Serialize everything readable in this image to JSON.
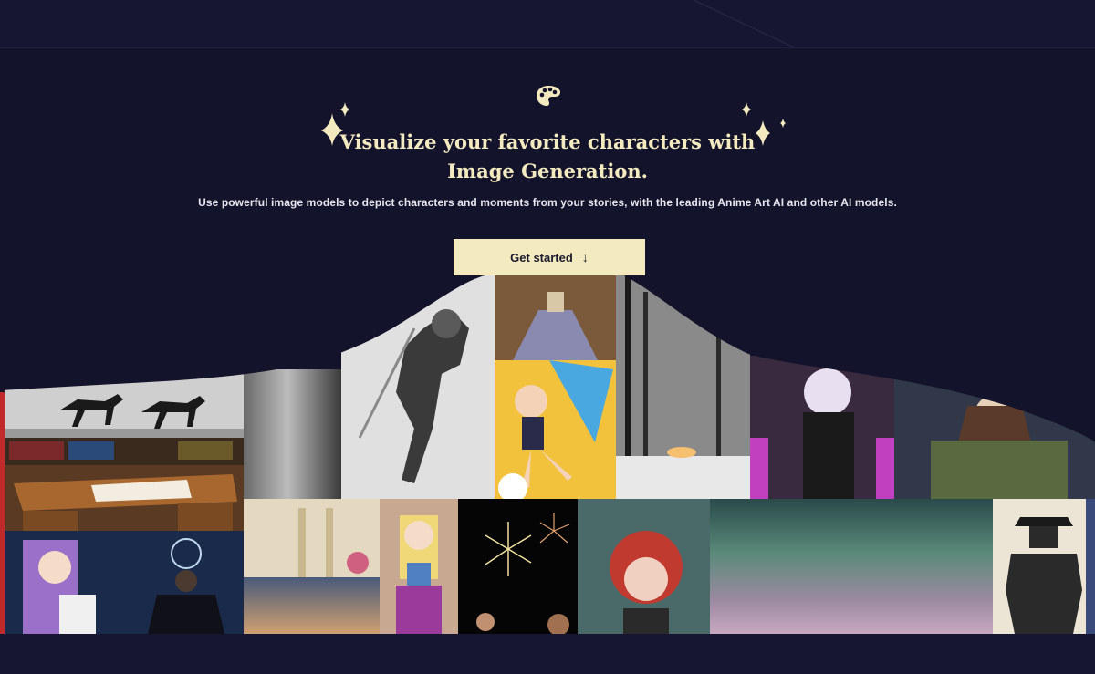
{
  "hero": {
    "title_line1": "Visualize your favorite characters with",
    "title_line2": "Image Generation.",
    "subtitle": "Use powerful image models to depict characters and moments from your stories, with the leading Anime Art AI and other AI models.",
    "cta_label": "Get started",
    "cta_icon": "arrow-down-icon"
  },
  "icons": {
    "palette": "palette-icon",
    "sparkles": "sparkle-icon"
  },
  "colors": {
    "background": "#13132b",
    "accent": "#f4eabf",
    "cta_text": "#1a1a2e"
  }
}
